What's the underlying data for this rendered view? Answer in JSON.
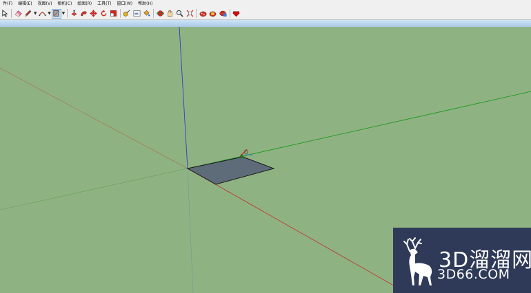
{
  "menu": {
    "items": [
      "件(F)",
      "编辑(E)",
      "视图(V)",
      "相机(C)",
      "绘图(R)",
      "工具(T)",
      "窗口(W)",
      "帮助(H)"
    ]
  },
  "toolbar": {
    "tools": [
      "select-arrow-icon",
      "eraser-icon",
      "pencil-line-icon",
      "arc-icon",
      "rectangle-icon",
      "pushpull-icon",
      "followme-icon",
      "move-icon",
      "rotate-icon",
      "scale-icon",
      "tape-measure-icon",
      "text-icon",
      "paint-bucket-icon",
      "orbit-icon",
      "pan-icon",
      "zoom-icon",
      "zoom-extents-icon",
      "warehouse-icon",
      "component-icon",
      "extension-icon",
      "ruby-icon"
    ],
    "selected_tool": "rectangle-icon"
  },
  "logo": {
    "cn_text": "3D溜溜网",
    "en_text": "3D66.COM"
  },
  "colors": {
    "viewport_bg": "#8fb283",
    "axis_red": "#b33a2a",
    "axis_green": "#1e9a1e",
    "axis_blue": "#2e3fc4",
    "face": "#5e6b78",
    "logo_bg": "#2f3a59"
  }
}
